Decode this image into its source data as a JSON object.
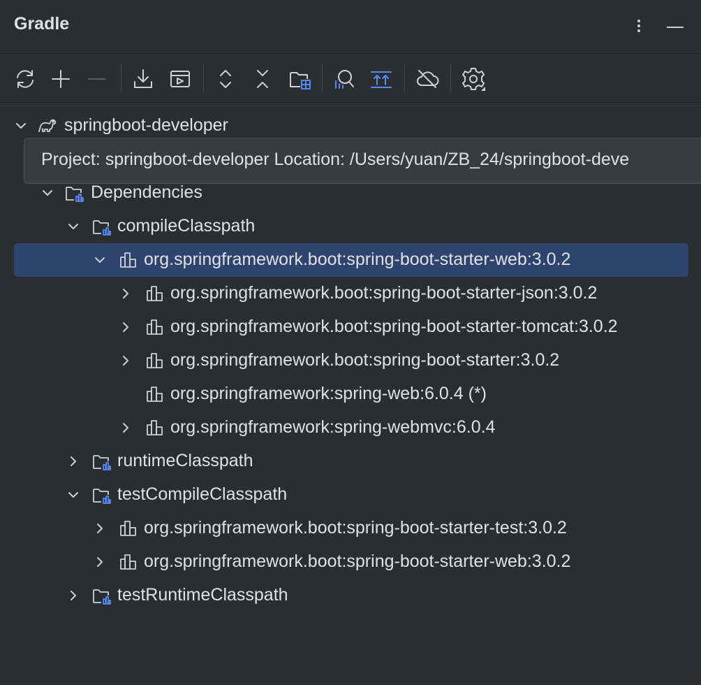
{
  "panel": {
    "title": "Gradle",
    "more_icon": "vertical-ellipsis-icon",
    "minimize_icon": "minimize-icon"
  },
  "toolbar": {
    "buttons": [
      {
        "name": "reload-all-gradle-projects-button",
        "icon": "sync-icon"
      },
      {
        "name": "link-gradle-project-button",
        "icon": "plus-icon"
      },
      {
        "name": "unlink-gradle-project-button",
        "icon": "minus-icon",
        "disabled": true
      },
      {
        "name": "download-sources-button",
        "icon": "download-icon"
      },
      {
        "name": "execute-gradle-task-button",
        "icon": "run-task-icon"
      },
      {
        "name": "expand-all-button",
        "icon": "expand-all-icon"
      },
      {
        "name": "collapse-all-button",
        "icon": "collapse-all-icon"
      },
      {
        "name": "group-modules-button",
        "icon": "folder-grid-icon"
      },
      {
        "name": "analyze-dependencies-button",
        "icon": "dependency-search-icon"
      },
      {
        "name": "show-dependencies-button",
        "icon": "dependencies-icon"
      },
      {
        "name": "toggle-offline-mode-button",
        "icon": "cloud-off-icon"
      },
      {
        "name": "build-tool-settings-button",
        "icon": "gear-icon"
      }
    ]
  },
  "colors": {
    "background": "#2b2d30",
    "selection": "#2e436e",
    "text": "#dfe1e5",
    "icon": "#ced0d6",
    "accent_blue": "#548af7"
  },
  "tooltip": {
    "text": "Project: springboot-developer Location: /Users/yuan/ZB_24/springboot-deve"
  },
  "tree": {
    "root": {
      "label": "springboot-developer",
      "expanded": true
    },
    "dependencies": {
      "label": "Dependencies",
      "expanded": true
    },
    "compile_classpath": {
      "label": "compileClasspath",
      "expanded": true
    },
    "starter_web": {
      "label": "org.springframework.boot:spring-boot-starter-web:3.0.2",
      "expanded": true,
      "selected": true
    },
    "starter_json": {
      "label": "org.springframework.boot:spring-boot-starter-json:3.0.2"
    },
    "starter_tomcat": {
      "label": "org.springframework.boot:spring-boot-starter-tomcat:3.0.2"
    },
    "starter": {
      "label": "org.springframework.boot:spring-boot-starter:3.0.2"
    },
    "spring_web": {
      "label": "org.springframework:spring-web:6.0.4 (*)"
    },
    "spring_webmvc": {
      "label": "org.springframework:spring-webmvc:6.0.4"
    },
    "runtime_classpath": {
      "label": "runtimeClasspath",
      "expanded": false
    },
    "test_compile_classpath": {
      "label": "testCompileClasspath",
      "expanded": true
    },
    "starter_test": {
      "label": "org.springframework.boot:spring-boot-starter-test:3.0.2"
    },
    "starter_web_test": {
      "label": "org.springframework.boot:spring-boot-starter-web:3.0.2"
    },
    "test_runtime_classpath": {
      "label": "testRuntimeClasspath",
      "expanded": false
    }
  }
}
